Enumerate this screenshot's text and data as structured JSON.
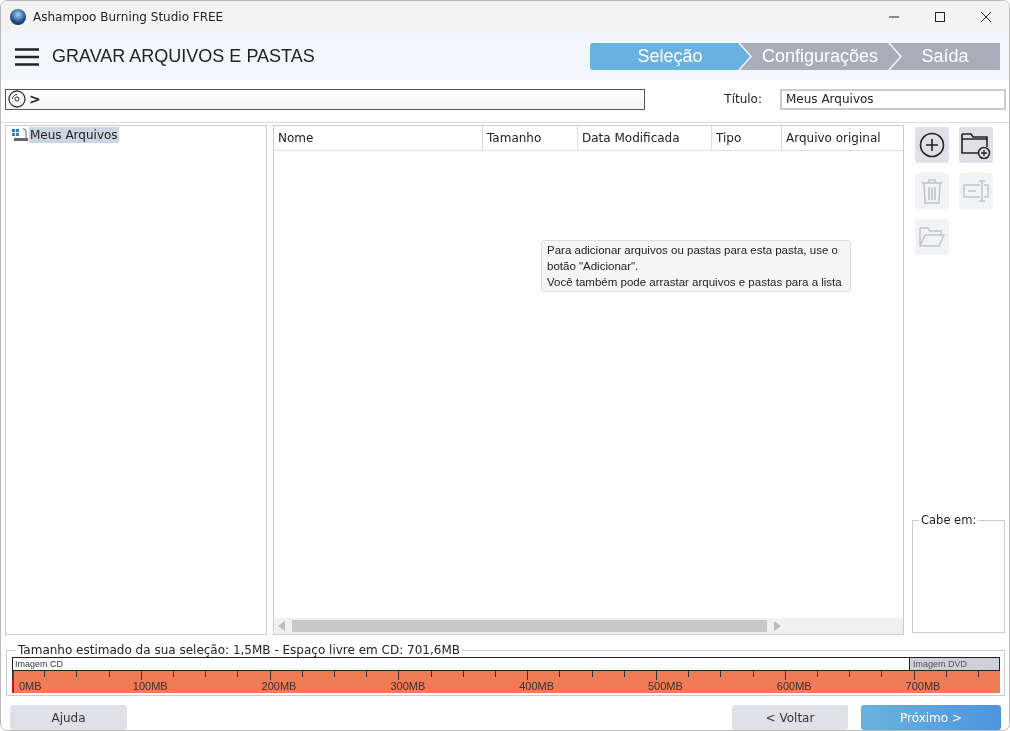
{
  "window": {
    "title": "Ashampoo Burning Studio FREE"
  },
  "header": {
    "title": "GRAVAR ARQUIVOS E PASTAS"
  },
  "steps": [
    {
      "label": "Seleção",
      "selected": true
    },
    {
      "label": "Configurações",
      "selected": false
    },
    {
      "label": "Saída",
      "selected": false
    }
  ],
  "path_bar": {
    "separator": ">"
  },
  "title_field": {
    "label": "Título:",
    "value": "Meus Arquivos"
  },
  "tree": {
    "items": [
      {
        "label": "Meus Arquivos",
        "selected": true
      }
    ]
  },
  "table": {
    "columns": [
      "Nome",
      "Tamanho",
      "Data Modificada",
      "Tipo",
      "Arquivo original"
    ],
    "hint": [
      "Para adicionar arquivos ou pastas para esta pasta, use o botão \"Adicionar\".",
      "Você também pode arrastar arquivos e pastas para a lista"
    ]
  },
  "tools": [
    {
      "kind": "add",
      "disabled": false
    },
    {
      "kind": "add-folder",
      "disabled": false
    },
    {
      "kind": "delete",
      "disabled": true
    },
    {
      "kind": "rename",
      "disabled": true
    },
    {
      "kind": "open-folder",
      "disabled": true
    }
  ],
  "fits_in": {
    "label": "Cabe em:"
  },
  "capacity": {
    "label": "Tamanho estimado da sua seleção: 1,5MB - Espaço livre em CD: 701,6MB",
    "cd_label": "Imagem CD",
    "dvd_label": "Imagem DVD",
    "level": 0.002,
    "ticks": [
      "0MB",
      "100MB",
      "200MB",
      "300MB",
      "400MB",
      "500MB",
      "600MB",
      "700MB"
    ]
  },
  "buttons": {
    "help": "Ajuda",
    "back": "< Voltar",
    "next": "Próximo >"
  }
}
